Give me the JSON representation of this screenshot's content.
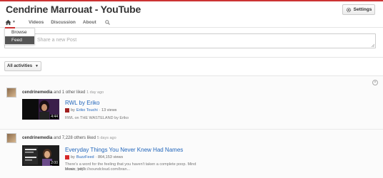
{
  "channel": {
    "title": "Cendrine Marrouat - YouTube"
  },
  "header": {
    "settings_label": "Settings"
  },
  "tabs": [
    {
      "label": "Videos"
    },
    {
      "label": "Discussion"
    },
    {
      "label": "About"
    }
  ],
  "home_menu": {
    "items": [
      {
        "label": "Browse"
      },
      {
        "label": "Feed"
      }
    ],
    "selected": "Feed"
  },
  "post": {
    "placeholder": "Share a new Post"
  },
  "filter": {
    "label": "All activities"
  },
  "colors": {
    "accent": "#cc3333",
    "link": "#2266bb",
    "selected_menu": "#555555"
  },
  "icons": [
    "gear-icon",
    "home-icon",
    "search-icon",
    "chevron-down-icon",
    "close-icon"
  ],
  "feed": [
    {
      "user": "cendrinemedia",
      "action": " and 1 other liked ",
      "time": "1 day ago",
      "video_title": "RWL by Eriko",
      "by_prefix": "by ",
      "channel": "Eriko Touchi",
      "views": " · 13 views",
      "duration": "4:44",
      "description": "RWL on THE WASTELAND by Eriko"
    },
    {
      "user": "cendrinemedia",
      "action": " and 7,228 others liked ",
      "time": "5 days ago",
      "video_title": "Everyday Things You Never Knew Had Names",
      "by_prefix": "by ",
      "channel": "BuzzFeed",
      "views": " · 864,153 views",
      "duration": "2:00",
      "description": "There's a word for the feeling that you haven't taken a complete poop. Mind blown, yet?",
      "description_2": "Music: https://soundcloud.com/bran..."
    }
  ]
}
